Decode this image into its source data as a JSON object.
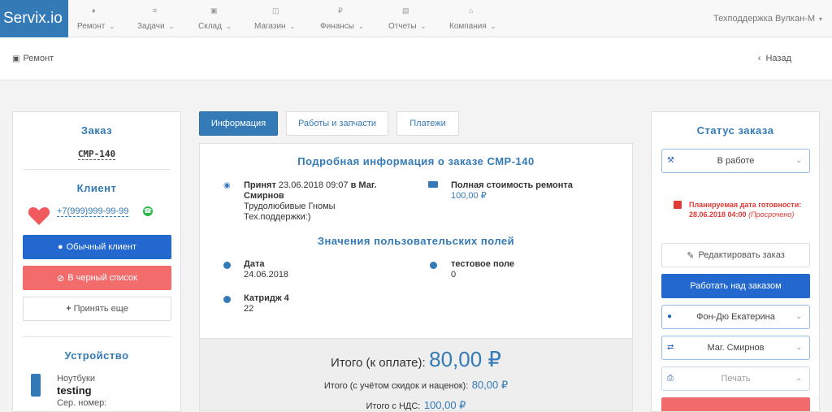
{
  "nav": {
    "brand": "Servix.io",
    "items": [
      {
        "label": "Ремонт"
      },
      {
        "label": "Задачи"
      },
      {
        "label": "Склад"
      },
      {
        "label": "Магазин"
      },
      {
        "label": "Финансы"
      },
      {
        "label": "Отчеты"
      },
      {
        "label": "Компания"
      }
    ],
    "support": "Техподдержка Вулкан-М"
  },
  "subbar": {
    "crumb": "Ремонт",
    "back": "Назад"
  },
  "left": {
    "order_title": "Заказ",
    "order_number": "СМР-140",
    "client_title": "Клиент",
    "phone": "+7(999)999-99-99",
    "btn_regular": "Обычный клиент",
    "btn_blacklist": "В черный список",
    "btn_accept": "Принять еще",
    "device_title": "Устройство",
    "device_type": "Ноутбуки",
    "device_name": "testing",
    "serial_label": "Сер. номер:"
  },
  "tabs": [
    "Информация",
    "Работы и запчасти",
    "Платежи"
  ],
  "info": {
    "title": "Подробная информация о заказе СМР-140",
    "accepted_prefix": "Принят",
    "accepted_date": "23.06.2018 09:07",
    "accepted_in": "в Маг.",
    "accepted_place": "Смирнов",
    "accepted_line2": "Трудолюбивые Гномы",
    "accepted_line3": "Тех.поддержки:)",
    "cost_label": "Полная стоимость ремонта",
    "cost_value": "100,00 ₽",
    "custom_title": "Значения пользовательских полей",
    "fields": [
      {
        "label": "Дата",
        "value": "24.06.2018"
      },
      {
        "label": "тестовое поле",
        "value": "0"
      },
      {
        "label": "Катридж 4",
        "value": "22"
      }
    ],
    "total_label": "Итого (к оплате):",
    "total_value": "80,00 ₽",
    "discount_label": "Итого (с учётом скидок и наценок):",
    "discount_value": "80,00 ₽",
    "vat_label": "Итого с НДС:",
    "vat_value": "100,00 ₽"
  },
  "status": {
    "title": "Статус заказа",
    "current": "В работе",
    "planned_label": "Планируемая дата готовности:",
    "planned_date": "28.06.2018 04:00",
    "overdue": "(Просрочено)",
    "edit": "Редактировать заказ",
    "work": "Работать над заказом",
    "master": "Фон-Дю Екатерина",
    "store": "Маг. Смирнов",
    "print": "Печать"
  }
}
